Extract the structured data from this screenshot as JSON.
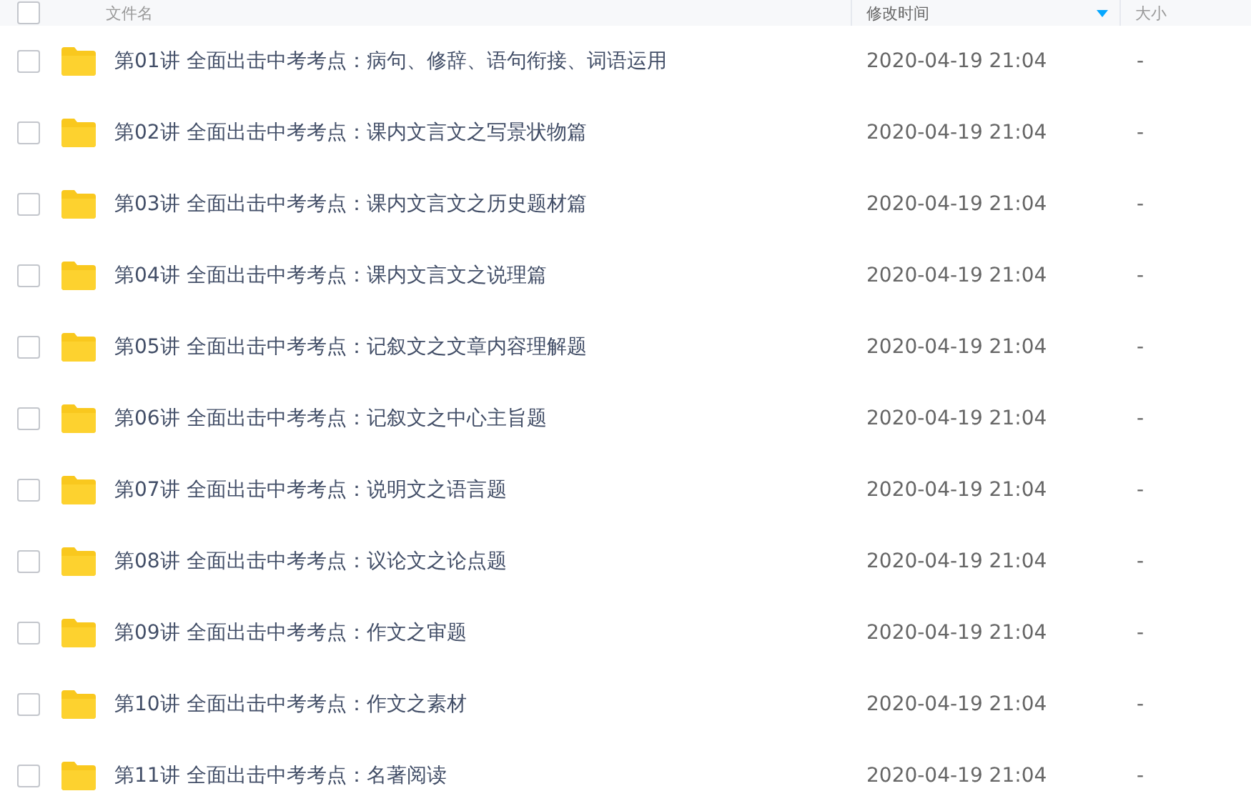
{
  "table": {
    "header_checked": false,
    "columns": [
      {
        "label": "文件名",
        "sorted": false
      },
      {
        "label": "修改时间",
        "sorted": true
      },
      {
        "label": "大小",
        "sorted": false
      }
    ],
    "rows": [
      {
        "name": "第01讲 全面出击中考考点：病句、修辞、语句衔接、词语运用",
        "modified": "2020-04-19 21:04",
        "size": "-",
        "checked": false
      },
      {
        "name": "第02讲 全面出击中考考点：课内文言文之写景状物篇",
        "modified": "2020-04-19 21:04",
        "size": "-",
        "checked": false
      },
      {
        "name": "第03讲 全面出击中考考点：课内文言文之历史题材篇",
        "modified": "2020-04-19 21:04",
        "size": "-",
        "checked": false
      },
      {
        "name": "第04讲 全面出击中考考点：课内文言文之说理篇",
        "modified": "2020-04-19 21:04",
        "size": "-",
        "checked": false
      },
      {
        "name": "第05讲 全面出击中考考点：记叙文之文章内容理解题",
        "modified": "2020-04-19 21:04",
        "size": "-",
        "checked": false
      },
      {
        "name": "第06讲 全面出击中考考点：记叙文之中心主旨题",
        "modified": "2020-04-19 21:04",
        "size": "-",
        "checked": false
      },
      {
        "name": "第07讲 全面出击中考考点：说明文之语言题",
        "modified": "2020-04-19 21:04",
        "size": "-",
        "checked": false
      },
      {
        "name": "第08讲 全面出击中考考点：议论文之论点题",
        "modified": "2020-04-19 21:04",
        "size": "-",
        "checked": false
      },
      {
        "name": "第09讲 全面出击中考考点：作文之审题",
        "modified": "2020-04-19 21:04",
        "size": "-",
        "checked": false
      },
      {
        "name": "第10讲 全面出击中考考点：作文之素材",
        "modified": "2020-04-19 21:04",
        "size": "-",
        "checked": false
      },
      {
        "name": "第11讲 全面出击中考考点：名著阅读",
        "modified": "2020-04-19 21:04",
        "size": "-",
        "checked": false
      }
    ]
  }
}
